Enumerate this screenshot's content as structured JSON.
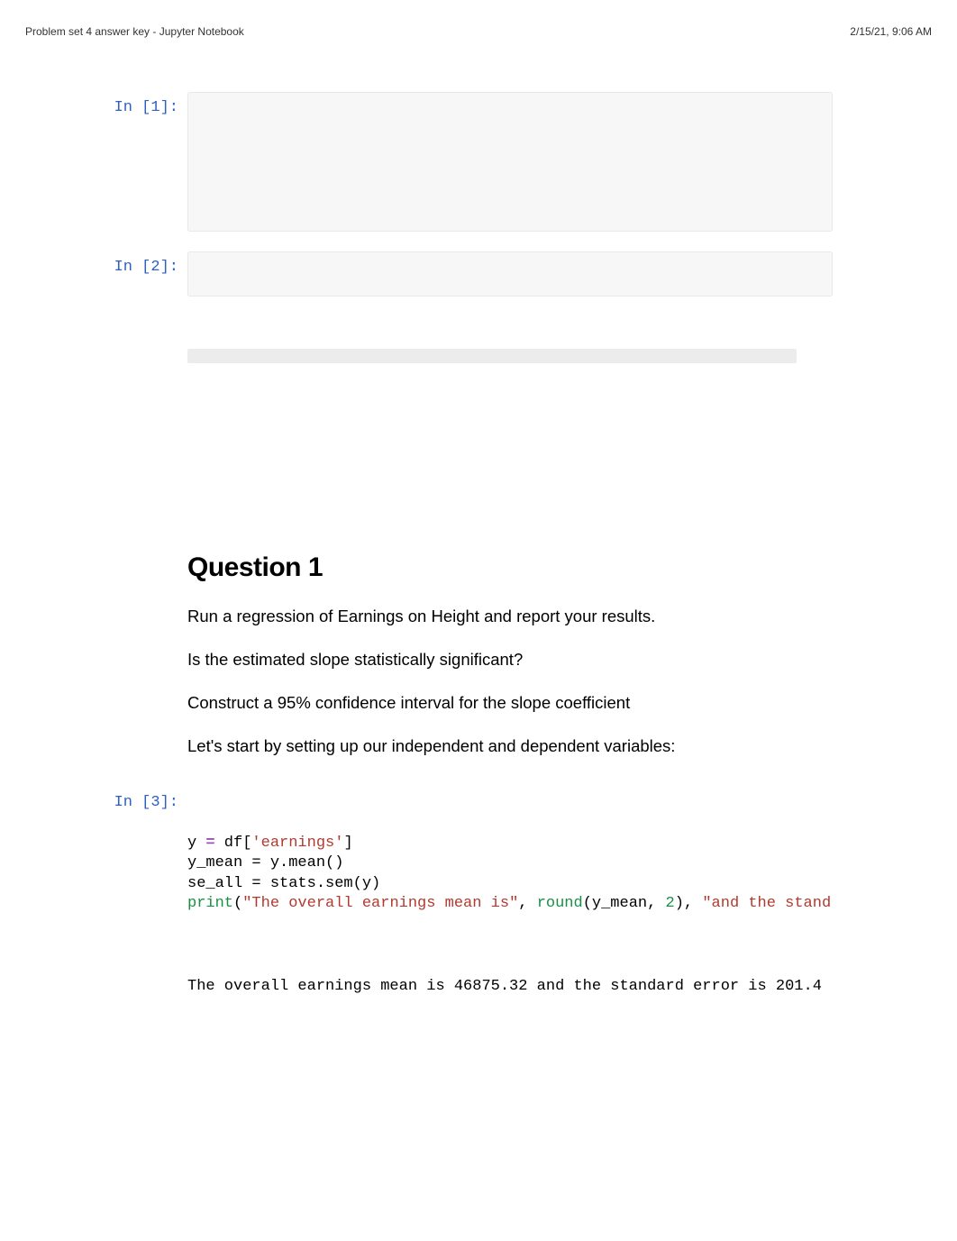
{
  "header": {
    "title": "Problem set 4 answer key - Jupyter Notebook",
    "timestamp": "2/15/21, 9:06 AM"
  },
  "cells": {
    "c1": {
      "prompt": "In [1]:"
    },
    "c2": {
      "prompt": "In [2]:"
    },
    "c3": {
      "prompt": "In [3]:",
      "code": {
        "l1_a": "y ",
        "l1_op": "=",
        "l1_b": " df[",
        "l1_str": "'earnings'",
        "l1_c": "]",
        "l2": "y_mean = y.mean()",
        "l3": "se_all = stats.sem(y)",
        "l4_fn": "print",
        "l4_a": "(",
        "l4_s1": "\"The overall earnings mean is\"",
        "l4_b": ", ",
        "l4_round": "round",
        "l4_c": "(y_mean, ",
        "l4_num": "2",
        "l4_d": "), ",
        "l4_s2": "\"and the stand",
        "l4_e": ""
      },
      "output": "The overall earnings mean is 46875.32 and the standard error is 201.4"
    }
  },
  "question": {
    "title": "Question 1",
    "p1": "Run a regression of Earnings on Height and report your results.",
    "p2": "Is the estimated slope statistically significant?",
    "p3": "Construct a 95% confidence interval for the slope coefficient",
    "p4": "Let's start by setting up our independent and dependent variables:"
  }
}
